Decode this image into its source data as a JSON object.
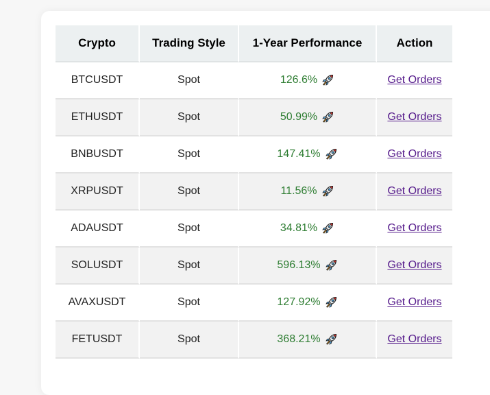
{
  "table": {
    "headers": [
      "Crypto",
      "Trading Style",
      "1-Year Performance",
      "Action"
    ],
    "rows": [
      {
        "crypto": "BTCUSDT",
        "style": "Spot",
        "performance": "126.6%",
        "icon": "rocket-icon",
        "action": "Get Orders"
      },
      {
        "crypto": "ETHUSDT",
        "style": "Spot",
        "performance": "50.99%",
        "icon": "rocket-icon",
        "action": "Get Orders"
      },
      {
        "crypto": "BNBUSDT",
        "style": "Spot",
        "performance": "147.41%",
        "icon": "rocket-icon",
        "action": "Get Orders"
      },
      {
        "crypto": "XRPUSDT",
        "style": "Spot",
        "performance": "11.56%",
        "icon": "rocket-icon",
        "action": "Get Orders"
      },
      {
        "crypto": "ADAUSDT",
        "style": "Spot",
        "performance": "34.81%",
        "icon": "rocket-icon",
        "action": "Get Orders"
      },
      {
        "crypto": "SOLUSDT",
        "style": "Spot",
        "performance": "596.13%",
        "icon": "rocket-icon",
        "action": "Get Orders"
      },
      {
        "crypto": "AVAXUSDT",
        "style": "Spot",
        "performance": "127.92%",
        "icon": "rocket-icon",
        "action": "Get Orders"
      },
      {
        "crypto": "FETUSDT",
        "style": "Spot",
        "performance": "368.21%",
        "icon": "rocket-icon",
        "action": "Get Orders"
      }
    ]
  },
  "colors": {
    "positive": "#2e7d32",
    "link": "#551a8b",
    "header_bg": "#ecf0f1",
    "stripe_bg": "#f2f2f2"
  }
}
